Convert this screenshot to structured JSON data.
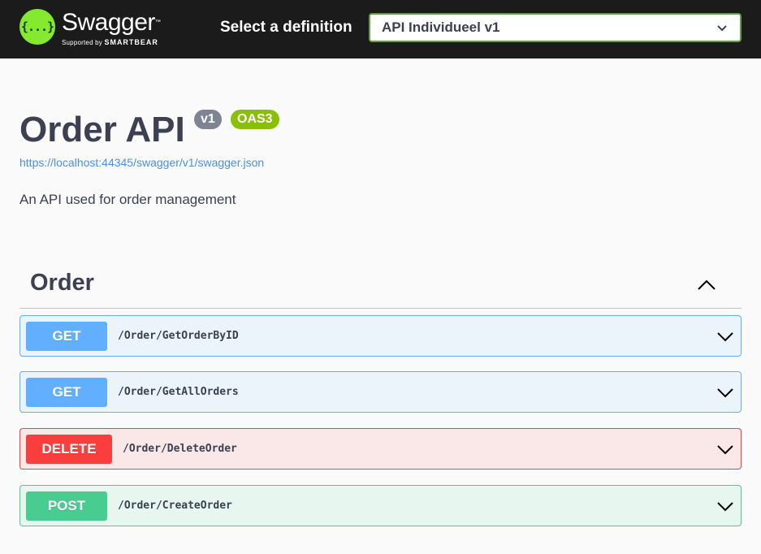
{
  "header": {
    "logo": {
      "title": "Swagger",
      "tm": "™",
      "supported_by": "Supported by",
      "company": "SMARTBEAR",
      "glyph": "{...}"
    },
    "definition_label": "Select a definition",
    "definition_selected": "API Individueel v1"
  },
  "info": {
    "title": "Order API",
    "version": "v1",
    "oas": "OAS3",
    "spec_url": "https://localhost:44345/swagger/v1/swagger.json",
    "description": "An API used for order management"
  },
  "tag": {
    "name": "Order",
    "expanded": true
  },
  "operations": [
    {
      "method": "GET",
      "path": "/Order/GetOrderByID"
    },
    {
      "method": "GET",
      "path": "/Order/GetAllOrders"
    },
    {
      "method": "DELETE",
      "path": "/Order/DeleteOrder"
    },
    {
      "method": "POST",
      "path": "/Order/CreateOrder"
    }
  ],
  "colors": {
    "topbar": "#1b1b1b",
    "logo": "#85ea2d",
    "get": "#61affe",
    "delete": "#f93e3e",
    "post": "#49cc90",
    "badge_version": "#7d8492",
    "badge_oas": "#89bf04",
    "link": "#4990e2"
  },
  "icons": {
    "select": "chevron-down-icon",
    "tag_toggle": "chevron-up-icon",
    "operation_toggle": "chevron-down-icon"
  }
}
